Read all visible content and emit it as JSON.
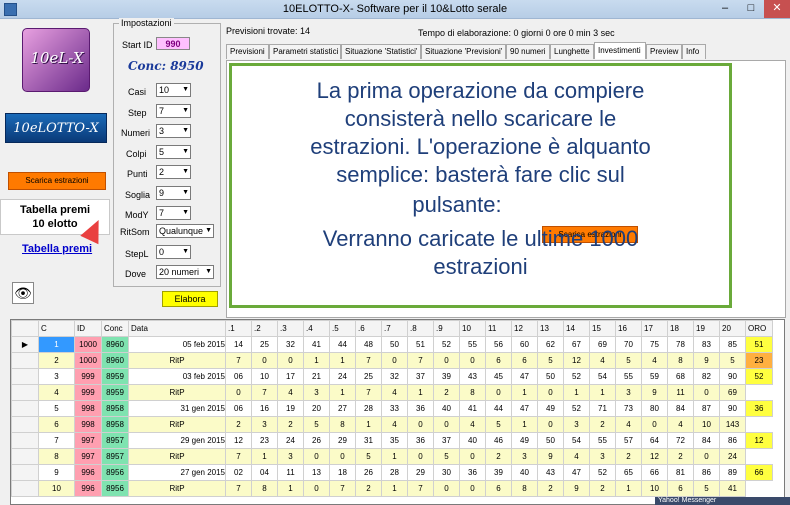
{
  "window": {
    "title": "10ELOTTO-X- Software per il 10&Lotto  serale",
    "min": "–",
    "max": "□",
    "close": "✕"
  },
  "logos": {
    "top": "10eL-X",
    "bottom": "10eLOTTO-X"
  },
  "left": {
    "scarica": "Scarica estrazioni",
    "tooltip_line1": "Tabella premi",
    "tooltip_line2": "10 elotto",
    "link": "Tabella premi",
    "eye": "👁"
  },
  "impostazioni": {
    "title": "Impostazioni",
    "startid_label": "Start ID",
    "startid": "990",
    "conc": "Conc: 8950",
    "fields": [
      {
        "label": "Casi",
        "value": "10"
      },
      {
        "label": "Step",
        "value": "7"
      },
      {
        "label": "Numeri",
        "value": "3"
      },
      {
        "label": "Colpi",
        "value": "5"
      },
      {
        "label": "Punti",
        "value": "2"
      },
      {
        "label": "Soglia",
        "value": "9"
      },
      {
        "label": "ModY",
        "value": "7"
      },
      {
        "label": "RitSom",
        "value": "Qualunque"
      },
      {
        "label": "StepL",
        "value": "0"
      },
      {
        "label": "Dove",
        "value": "20 numeri"
      }
    ],
    "elabora": "Elabora"
  },
  "status": {
    "previsioni": "Previsioni trovate: 14",
    "tempo": "Tempo di elaborazione: 0 giorni 0 ore 0 min 3 sec"
  },
  "tabs": [
    "Previsioni",
    "Parametri statistici",
    "Situazione 'Statistici'",
    "Situazione 'Previsioni'",
    "90 numeri",
    "Lunghette",
    "Investimenti",
    "Preview",
    "Info"
  ],
  "message": {
    "l1": "La prima operazione da compiere",
    "l2": "consisterà nello scaricare le",
    "l3": "estrazioni. L'operazione è alquanto",
    "l4": "semplice: basterà fare clic sul",
    "l5": "pulsante:",
    "btn": "Scarica estrazioni",
    "l6": "Verranno caricate le ultime 1000",
    "l7": "estrazioni"
  },
  "grid": {
    "headers": [
      "",
      "C",
      "ID",
      "Conc",
      "Data",
      ".1",
      ".2",
      ".3",
      ".4",
      ".5",
      ".6",
      ".7",
      ".8",
      ".9",
      "10",
      "11",
      "12",
      "13",
      "14",
      "15",
      "16",
      "17",
      "18",
      "19",
      "20",
      "ORO"
    ],
    "rows": [
      [
        "▶",
        "1",
        "1000",
        "8960",
        "05 feb 2015",
        "14",
        "25",
        "32",
        "41",
        "44",
        "48",
        "50",
        "51",
        "52",
        "55",
        "56",
        "60",
        "62",
        "67",
        "69",
        "70",
        "75",
        "78",
        "83",
        "85",
        "51"
      ],
      [
        "",
        "2",
        "1000",
        "8960",
        "RitP",
        "7",
        "0",
        "0",
        "1",
        "1",
        "7",
        "0",
        "7",
        "0",
        "0",
        "6",
        "6",
        "5",
        "12",
        "4",
        "5",
        "4",
        "8",
        "9",
        "5",
        "23"
      ],
      [
        "",
        "3",
        "999",
        "8959",
        "03 feb 2015",
        "06",
        "10",
        "17",
        "21",
        "24",
        "25",
        "32",
        "37",
        "39",
        "43",
        "45",
        "47",
        "50",
        "52",
        "54",
        "55",
        "59",
        "68",
        "82",
        "90",
        "52"
      ],
      [
        "",
        "4",
        "999",
        "8959",
        "RitP",
        "0",
        "7",
        "4",
        "3",
        "1",
        "7",
        "4",
        "1",
        "2",
        "8",
        "0",
        "1",
        "0",
        "1",
        "1",
        "3",
        "9",
        "11",
        "0",
        "69"
      ],
      [
        "",
        "5",
        "998",
        "8958",
        "31 gen 2015",
        "06",
        "16",
        "19",
        "20",
        "27",
        "28",
        "33",
        "36",
        "40",
        "41",
        "44",
        "47",
        "49",
        "52",
        "71",
        "73",
        "80",
        "84",
        "87",
        "90",
        "36"
      ],
      [
        "",
        "6",
        "998",
        "8958",
        "RitP",
        "2",
        "3",
        "2",
        "5",
        "8",
        "1",
        "4",
        "0",
        "0",
        "4",
        "5",
        "1",
        "0",
        "3",
        "2",
        "4",
        "0",
        "4",
        "10",
        "143"
      ],
      [
        "",
        "7",
        "997",
        "8957",
        "29 gen 2015",
        "12",
        "23",
        "24",
        "26",
        "29",
        "31",
        "35",
        "36",
        "37",
        "40",
        "46",
        "49",
        "50",
        "54",
        "55",
        "57",
        "64",
        "72",
        "84",
        "86",
        "12"
      ],
      [
        "",
        "8",
        "997",
        "8957",
        "RitP",
        "7",
        "1",
        "3",
        "0",
        "0",
        "5",
        "1",
        "0",
        "5",
        "0",
        "2",
        "3",
        "9",
        "4",
        "3",
        "2",
        "12",
        "2",
        "0",
        "24"
      ],
      [
        "",
        "9",
        "996",
        "8956",
        "27 gen 2015",
        "02",
        "04",
        "11",
        "13",
        "18",
        "26",
        "28",
        "29",
        "30",
        "36",
        "39",
        "40",
        "43",
        "47",
        "52",
        "65",
        "66",
        "81",
        "86",
        "89",
        "66"
      ],
      [
        "",
        "10",
        "996",
        "8956",
        "RitP",
        "7",
        "8",
        "1",
        "0",
        "7",
        "2",
        "1",
        "7",
        "0",
        "0",
        "6",
        "8",
        "2",
        "9",
        "2",
        "1",
        "10",
        "6",
        "5",
        "41"
      ]
    ]
  },
  "messenger": "Yahoo! Messenger",
  "colors": {
    "accent_orange": "#ff7a00",
    "id_pink": "#ff9fb0",
    "conc_green": "#7fe3b0",
    "oro_yellow": "#ffff40",
    "oro_orange": "#ffb040",
    "oro_red": "#ff6060",
    "selected_blue": "#3399ff"
  }
}
